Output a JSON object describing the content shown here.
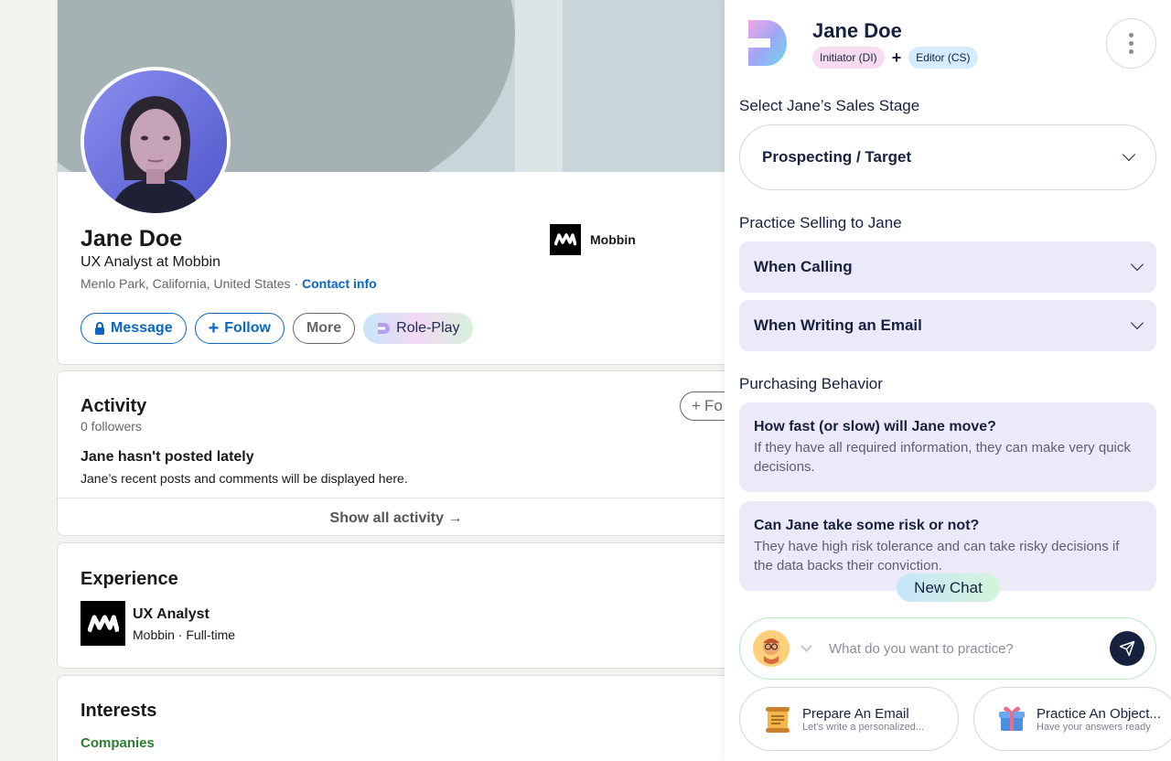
{
  "profile": {
    "name": "Jane Doe",
    "headline": "UX Analyst at Mobbin",
    "location": "Menlo Park, California, United States · ",
    "contact_link": "Contact info",
    "company": "Mobbin",
    "actions": {
      "message": "Message",
      "follow": "Follow",
      "more": "More",
      "roleplay": "Role-Play"
    }
  },
  "activity": {
    "title": "Activity",
    "followers": "0 followers",
    "follow_button": "Fo",
    "empty_title": "Jane hasn't posted lately",
    "empty_text": "Jane’s recent posts and comments will be displayed here.",
    "show_all": "Show all activity →"
  },
  "experience": {
    "title": "Experience",
    "role": "UX Analyst",
    "company_line": "Mobbin · Full-time"
  },
  "interests": {
    "title": "Interests",
    "tab": "Companies"
  },
  "panel": {
    "name": "Jane Doe",
    "tag1": "Initiator (DI)",
    "tag_plus": "+",
    "tag2": "Editor (CS)",
    "stage_label": "Select Jane’s Sales Stage",
    "stage_value": "Prospecting / Target",
    "practice_label": "Practice Selling to Jane",
    "practice_items": [
      "When Calling",
      "When Writing an Email"
    ],
    "behavior_label": "Purchasing Behavior",
    "behavior": [
      {
        "title": "How fast (or slow) will Jane move?",
        "text": "If they have all required information, they can make very quick decisions."
      },
      {
        "title": "Can Jane take some risk or not?",
        "text": "They have high risk tolerance and can take risky decisions if the data backs their conviction."
      }
    ],
    "new_chat": "New Chat",
    "chat_placeholder": "What do you want to practice?",
    "suggestions": [
      {
        "title": "Prepare An Email",
        "sub": "Let’s write a personalized...",
        "icon": "scroll-icon"
      },
      {
        "title": "Practice An Object...",
        "sub": "Have your answers ready",
        "icon": "gift-icon"
      }
    ]
  },
  "colors": {
    "linkedin_blue": "#0a66c2",
    "panel_text": "#16213e",
    "accordion_bg": "#ece9f8"
  }
}
